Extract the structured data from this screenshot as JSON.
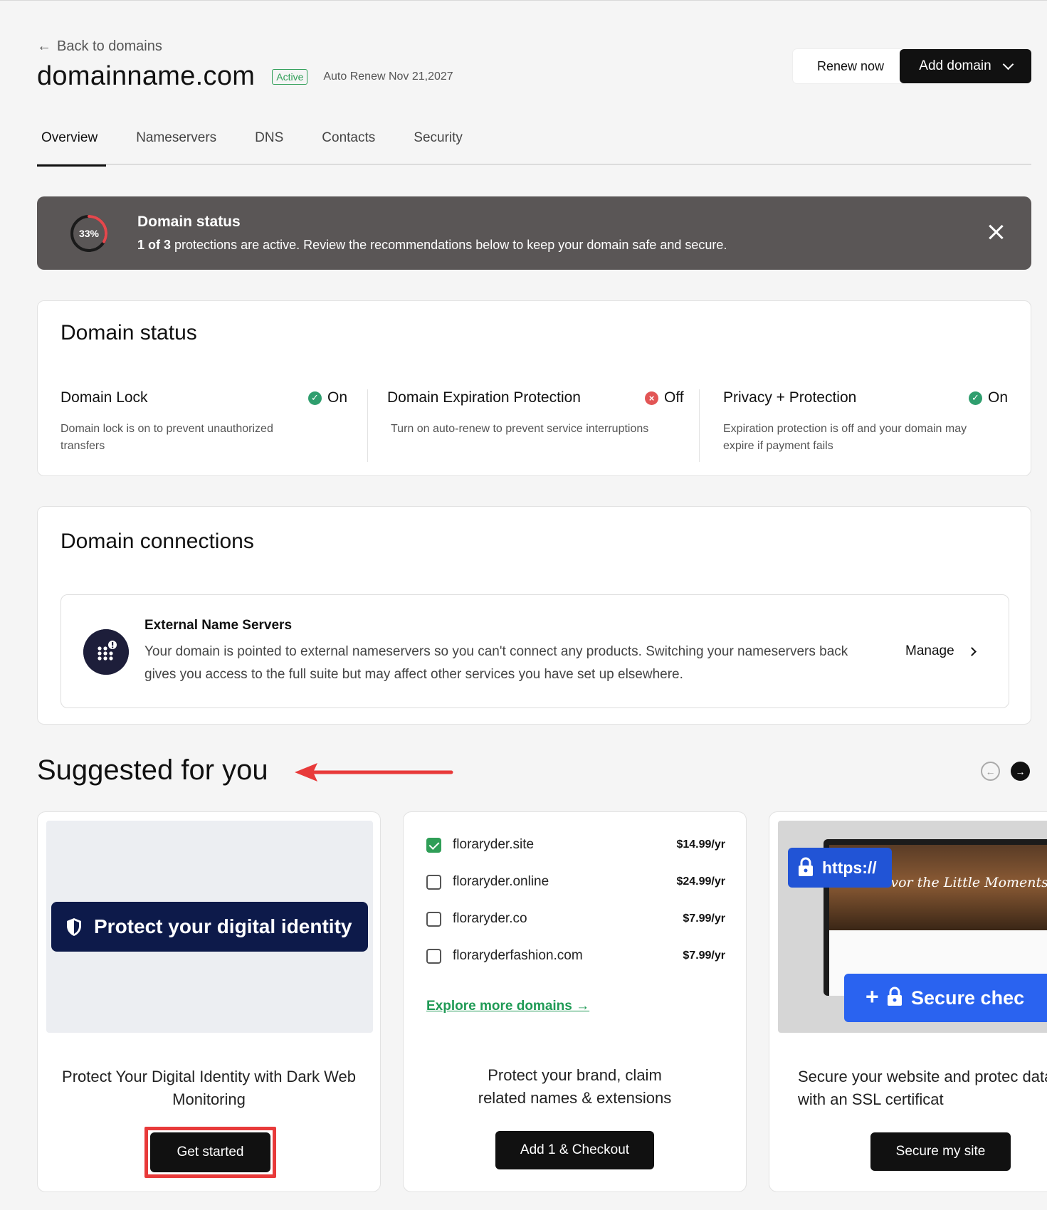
{
  "header": {
    "back_label": "Back to domains",
    "domain": "domainname.com",
    "badge": "Active",
    "auto_renew": "Auto Renew Nov 21,2027",
    "renew_label": "Renew now",
    "add_label": "Add domain"
  },
  "tabs": [
    {
      "label": "Overview",
      "active": true
    },
    {
      "label": "Nameservers",
      "active": false
    },
    {
      "label": "DNS",
      "active": false
    },
    {
      "label": "Contacts",
      "active": false
    },
    {
      "label": "Security",
      "active": false
    }
  ],
  "banner": {
    "percent": "33%",
    "progress": 0.33,
    "title": "Domain status",
    "count": "1 of 3",
    "text": " protections are active. Review the recommendations below to keep your domain safe and secure."
  },
  "status": {
    "heading": "Domain status",
    "items": [
      {
        "label": "Domain Lock",
        "state": "On",
        "ok": true,
        "desc": "Domain lock is on to prevent unauthorized transfers"
      },
      {
        "label": "Domain Expiration Protection",
        "state": "Off",
        "ok": false,
        "desc": "Turn on auto-renew to prevent service interruptions"
      },
      {
        "label": "Privacy + Protection",
        "state": "On",
        "ok": true,
        "desc": "Expiration protection is off and your domain may expire if payment fails"
      }
    ]
  },
  "connections": {
    "heading": "Domain connections",
    "ns_title": "External Name Servers",
    "ns_desc": "Your domain is pointed to external nameservers so you can't connect any products. Switching your nameservers back gives you access to the full suite but may affect other services you have set up elsewhere.",
    "manage_label": "Manage"
  },
  "suggested": {
    "heading": "Suggested for you",
    "card1": {
      "pill": "Protect your digital identity",
      "title": "Protect Your Digital Identity with Dark Web Monitoring",
      "button": "Get started"
    },
    "card2": {
      "domains": [
        {
          "name": "floraryder.site",
          "price": "$14.99/yr",
          "checked": true
        },
        {
          "name": "floraryder.online",
          "price": "$24.99/yr",
          "checked": false
        },
        {
          "name": "floraryder.co",
          "price": "$7.99/yr",
          "checked": false
        },
        {
          "name": "floraryderfashion.com",
          "price": "$7.99/yr",
          "checked": false
        }
      ],
      "explore": "Explore more domains →",
      "title": "Protect your brand, claim related names & extensions",
      "button": "Add 1 & Checkout"
    },
    "card3": {
      "https": "https://",
      "savor": "Savor the Little Moments",
      "secure_check": "Secure chec",
      "title": "Secure your website and protec data with an SSL certificat",
      "button": "Secure my site"
    }
  },
  "colors": {
    "accent_green": "#2f9e57",
    "banner_bg": "#5a5656",
    "pill_navy": "#0d1a4a",
    "ssl_blue": "#2a63f0",
    "annotation_red": "#e83a3a"
  }
}
